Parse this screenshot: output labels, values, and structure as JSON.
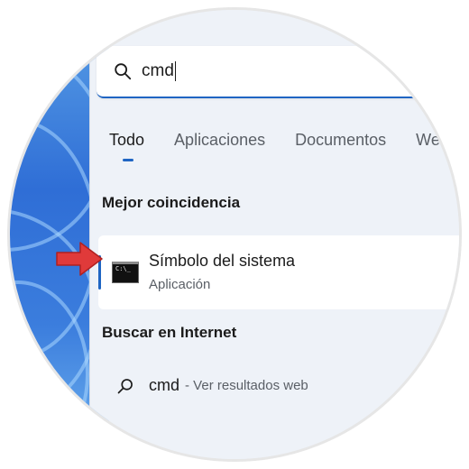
{
  "search": {
    "query": "cmd"
  },
  "tabs": [
    {
      "label": "Todo",
      "active": true
    },
    {
      "label": "Aplicaciones"
    },
    {
      "label": "Documentos"
    },
    {
      "label": "We"
    }
  ],
  "best_match": {
    "heading": "Mejor coincidencia",
    "title": "Símbolo del sistema",
    "subtitle": "Aplicación",
    "icon": "command-prompt-icon"
  },
  "internet": {
    "heading": "Buscar en Internet",
    "query": "cmd",
    "hint": "- Ver resultados web"
  },
  "colors": {
    "accent": "#1f65c3",
    "arrow": "#e03a3a",
    "panel": "#eef2f8"
  }
}
